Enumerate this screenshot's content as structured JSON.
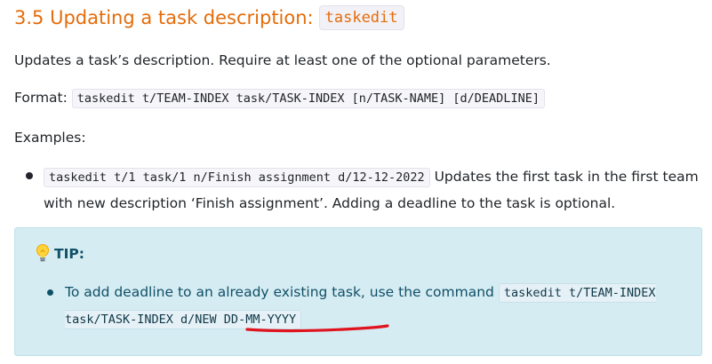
{
  "section": {
    "title": "3.5 Updating a task description:",
    "title_code": "taskedit",
    "description": "Updates a task’s description. Require at least one of the optional parameters.",
    "format_label": "Format:",
    "format_code": "taskedit t/TEAM-INDEX task/TASK-INDEX [n/TASK-NAME] [d/DEADLINE]",
    "examples_label": "Examples:",
    "example": {
      "code": "taskedit t/1 task/1 n/Finish assignment d/12-12-2022",
      "text": "Updates the first task in the first team with new description ‘Finish assignment’. Adding a deadline to the task is optional."
    }
  },
  "tip": {
    "icon": "lightbulb-icon",
    "title": "TIP:",
    "text": "To add deadline to an already existing task, use the command",
    "code": "taskedit t/TEAM-INDEX task/TASK-INDEX d/NEW DD-MM-YYYY",
    "annotation_color": "#e0141e"
  },
  "colors": {
    "heading": "#e46c0a",
    "tip_background": "#d6ecf3",
    "tip_text": "#0f5066"
  }
}
